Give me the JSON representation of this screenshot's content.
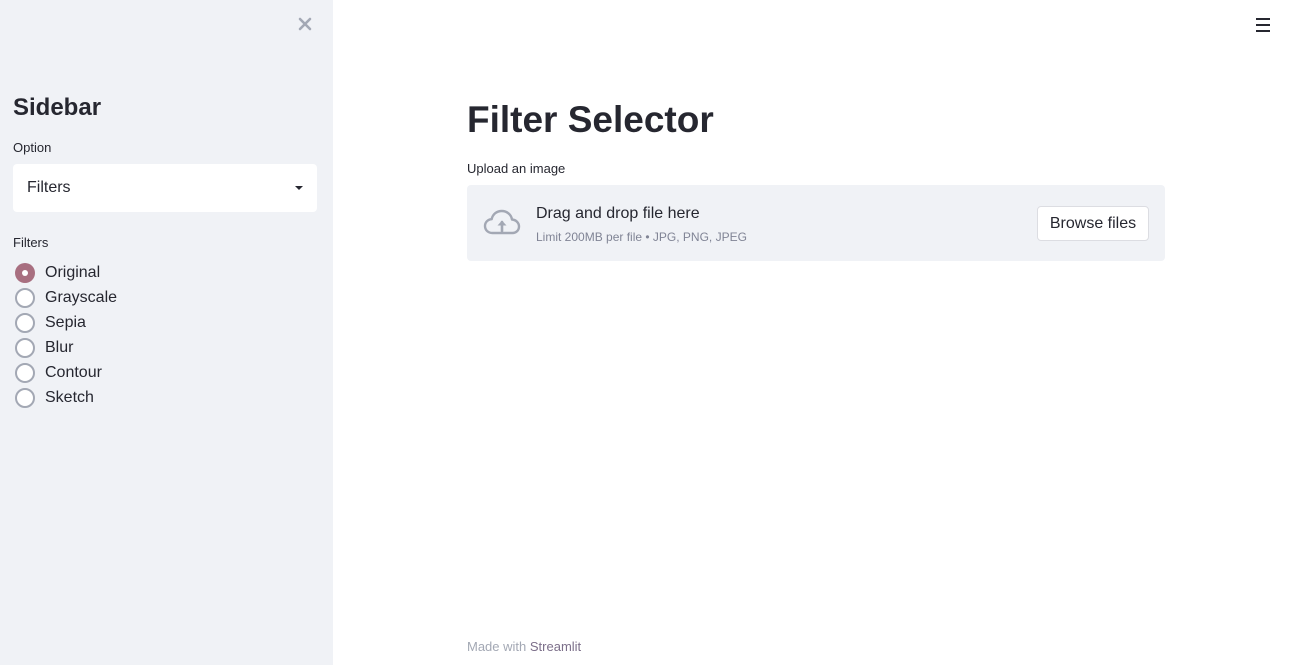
{
  "sidebar": {
    "close_icon": "close-icon",
    "title": "Sidebar",
    "option_label": "Option",
    "option_value": "Filters",
    "filters_label": "Filters",
    "filters": [
      {
        "label": "Original",
        "checked": true
      },
      {
        "label": "Grayscale",
        "checked": false
      },
      {
        "label": "Sepia",
        "checked": false
      },
      {
        "label": "Blur",
        "checked": false
      },
      {
        "label": "Contour",
        "checked": false
      },
      {
        "label": "Sketch",
        "checked": false
      }
    ]
  },
  "header": {
    "menu_icon": "hamburger-menu-icon"
  },
  "main": {
    "title": "Filter Selector",
    "uploader": {
      "label": "Upload an image",
      "icon": "cloud-upload-icon",
      "drop_text": "Drag and drop file here",
      "limit_text": "Limit 200MB per file • JPG, PNG, JPEG",
      "browse_label": "Browse files"
    }
  },
  "footer": {
    "prefix": "Made with",
    "link": "Streamlit"
  },
  "colors": {
    "sidebar_bg": "#f0f2f6",
    "accent": "#a86f80",
    "text": "#262730",
    "muted": "#808495"
  }
}
